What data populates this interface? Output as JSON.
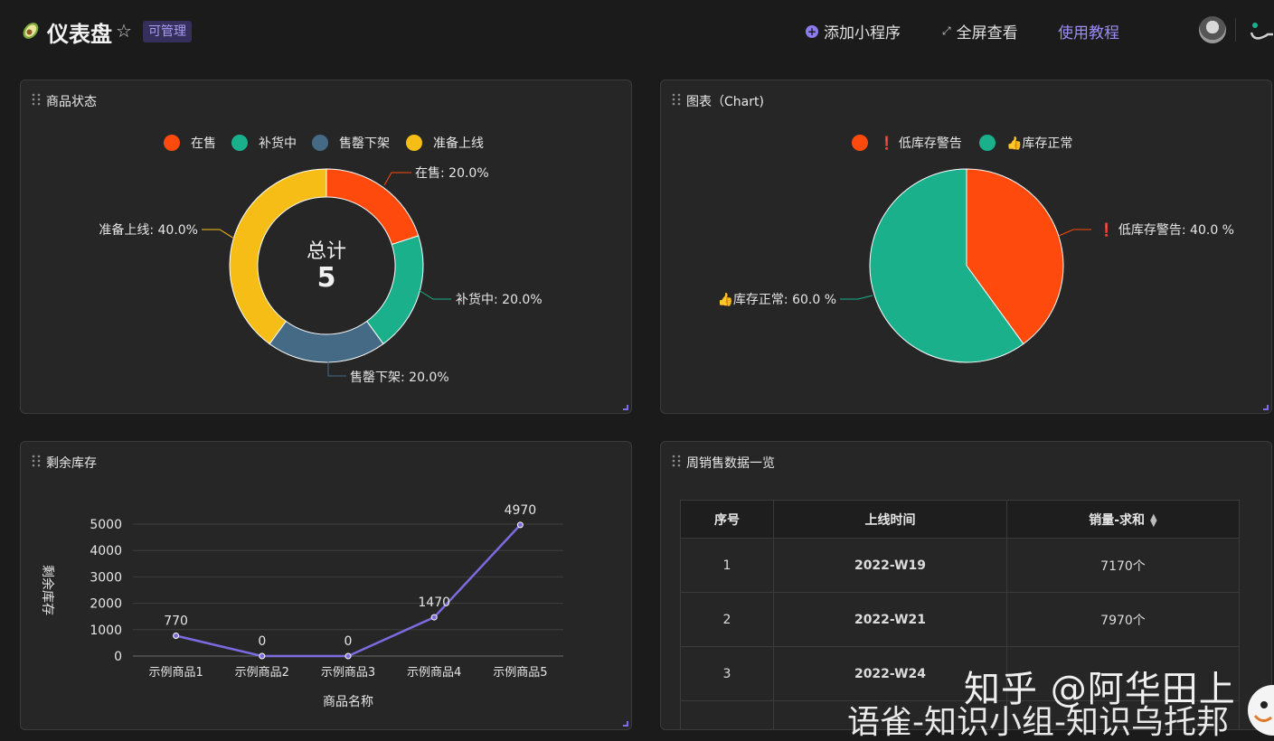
{
  "header": {
    "title": "仪表盘",
    "star": "☆",
    "badge": "可管理",
    "add_mini_program": "添加小程序",
    "fullscreen": "全屏查看",
    "tutorial": "使用教程"
  },
  "cards": {
    "status": {
      "title": "商品状态",
      "center_label": "总计",
      "center_value": "5",
      "legend": [
        {
          "label": "在售",
          "color": "#ff4a0d"
        },
        {
          "label": "补货中",
          "color": "#1ab08b"
        },
        {
          "label": "售罄下架",
          "color": "#446a85"
        },
        {
          "label": "准备上线",
          "color": "#f6bd16"
        }
      ],
      "slices": [
        {
          "name": "在售",
          "percent": 20.0,
          "label": "在售: 20.0%",
          "color": "#ff4a0d"
        },
        {
          "name": "补货中",
          "percent": 20.0,
          "label": "补货中: 20.0%",
          "color": "#1ab08b"
        },
        {
          "name": "售罄下架",
          "percent": 20.0,
          "label": "售罄下架: 20.0%",
          "color": "#446a85"
        },
        {
          "name": "准备上线",
          "percent": 40.0,
          "label": "准备上线: 40.0%",
          "color": "#f6bd16"
        }
      ]
    },
    "chart": {
      "title": "图表（Chart)",
      "legend": [
        {
          "label": "❗ 低库存警告",
          "color": "#ff4a0d"
        },
        {
          "label": "👍库存正常",
          "color": "#1ab08b"
        }
      ],
      "slices": [
        {
          "name": "❗ 低库存警告",
          "percent": 40.0,
          "label": "❗ 低库存警告: 40.0 %",
          "color": "#ff4a0d"
        },
        {
          "name": "👍库存正常",
          "percent": 60.0,
          "label": "👍库存正常: 60.0 %",
          "color": "#1ab08b"
        }
      ]
    },
    "stock": {
      "title": "剩余库存"
    },
    "weekly": {
      "title": "周销售数据一览",
      "columns": [
        "序号",
        "上线时间",
        "销量-求和"
      ],
      "rows": [
        {
          "index": "1",
          "week": "2022-W19",
          "sales": "7170个"
        },
        {
          "index": "2",
          "week": "2022-W21",
          "sales": "7970个"
        },
        {
          "index": "3",
          "week": "2022-W24",
          "sales": ""
        }
      ]
    }
  },
  "chart_data": [
    {
      "type": "pie",
      "title": "",
      "categories": [
        "在售",
        "补货中",
        "售罄下架",
        "准备上线"
      ],
      "values": [
        20.0,
        20.0,
        20.0,
        40.0
      ],
      "donut": true,
      "legend": "top"
    },
    {
      "type": "pie",
      "title": "",
      "categories": [
        "❗ 低库存警告",
        "👍库存正常"
      ],
      "values": [
        40.0,
        60.0
      ],
      "legend": "top"
    },
    {
      "type": "line",
      "xlabel": "商品名称",
      "ylabel": "剩余库存",
      "categories": [
        "示例商品1",
        "示例商品2",
        "示例商品3",
        "示例商品4",
        "示例商品5"
      ],
      "values": [
        770,
        0,
        0,
        1470,
        4970
      ],
      "ylim": [
        0,
        5000
      ],
      "yticks": [
        0,
        1000,
        2000,
        3000,
        4000,
        5000
      ],
      "grid": true,
      "color": "#7a6bdf"
    }
  ],
  "watermark": {
    "line1": "知乎 @阿华田上",
    "line2": "语雀-知识小组-知识乌托邦"
  }
}
